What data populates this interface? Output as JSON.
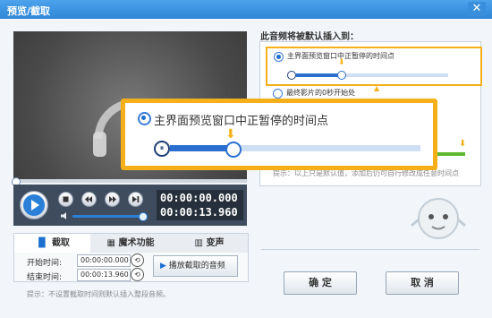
{
  "window": {
    "title": "预览/截取",
    "close_glyph": "✕"
  },
  "player": {
    "current_time": "00:00:00.000",
    "total_time": "00:00:13.960",
    "progress": 0.0,
    "volume": 0.88
  },
  "tabs": [
    {
      "label": "截取",
      "active": true
    },
    {
      "label": "魔术功能",
      "active": false
    },
    {
      "label": "变声",
      "active": false
    }
  ],
  "cut": {
    "start_label": "开始时间:",
    "start_value": "00:00:00.000",
    "end_label": "结束时间:",
    "end_value": "00:00:13.960",
    "play_button": "播放截取的音频",
    "hint": "提示：不设置截取时间则默认插入整段音频。"
  },
  "insert": {
    "heading": "此音频将被默认插入到：",
    "option1": "主界面预览窗口中正暂停的时间点",
    "option2": "最终影片的0秒开始处",
    "hint": "提示：以上只是默认值，添加后仍可自行修改成任意时间点"
  },
  "popup": {
    "label": "主界面预览窗口中正暂停的时间点",
    "marker_position": 0.32
  },
  "buttons": {
    "ok": "确 定",
    "cancel": "取 消"
  },
  "colors": {
    "title_bar": "#2e86d6",
    "highlight": "#f5b019",
    "accent": "#1e6fd0",
    "green_bar": "#5cb82e"
  }
}
